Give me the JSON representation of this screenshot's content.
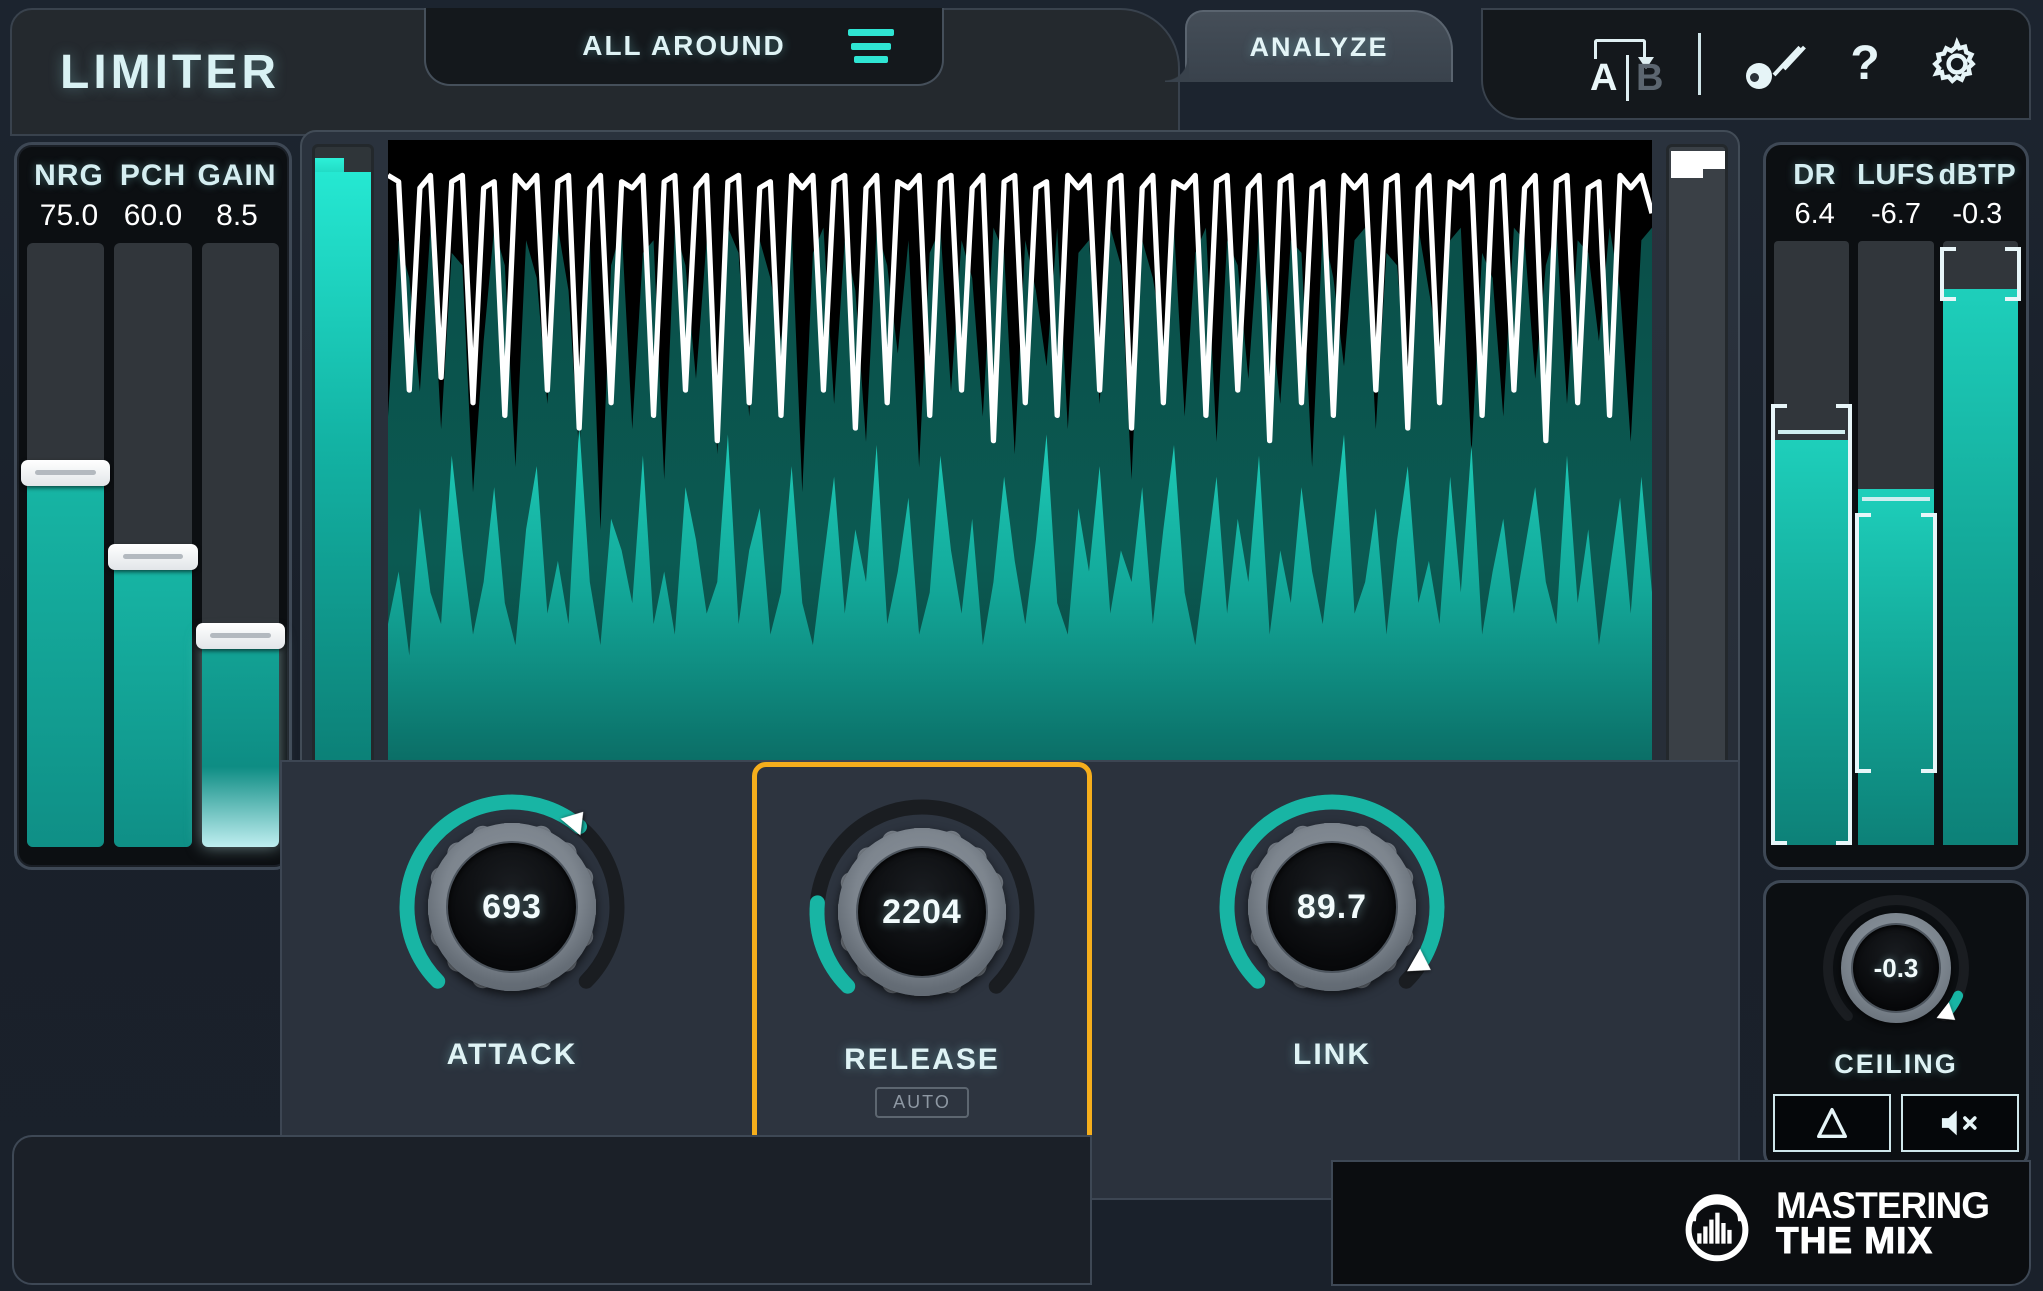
{
  "header": {
    "brand": "LIMITER",
    "preset_tab": "ALL AROUND",
    "menu_icon": "hamburger-icon",
    "analyze_tab": "ANALYZE",
    "ab_a": "A",
    "ab_b": "B",
    "help_label": "?",
    "wand_icon": "magic-wand-icon",
    "gear_icon": "gear-icon"
  },
  "left_meters": {
    "columns": [
      {
        "label": "NRG",
        "value": "75.0",
        "fill_pct": 62,
        "handle_pct": 62,
        "glow": false
      },
      {
        "label": "PCH",
        "value": "60.0",
        "fill_pct": 48,
        "handle_pct": 48,
        "glow": false
      },
      {
        "label": "GAIN",
        "value": "8.5",
        "fill_pct": 35,
        "handle_pct": 35,
        "glow": true
      }
    ]
  },
  "right_meters": {
    "columns": [
      {
        "label": "DR",
        "value": "6.4",
        "fill_pct": 67,
        "bracket_top_pct": 73,
        "bracket_height_pct": 73,
        "tick_pct": 68
      },
      {
        "label": "LUFS",
        "value": "-6.7",
        "fill_pct": 59,
        "bracket_top_pct": 55,
        "bracket_height_pct": 43,
        "tick_pct": 57
      },
      {
        "label": "dBTP",
        "value": "-0.3",
        "fill_pct": 92,
        "bracket_top_pct": 99,
        "bracket_height_pct": 9,
        "tick_pct": 0
      }
    ]
  },
  "gain_meter": {
    "input_level_pct": 96,
    "output_marker_pct": 3
  },
  "knobs": [
    {
      "name": "ATTACK",
      "value": "693",
      "arc_start_deg": -135,
      "arc_end_deg": 40,
      "selected": false,
      "auto": null
    },
    {
      "name": "RELEASE",
      "value": "2204",
      "arc_start_deg": -135,
      "arc_end_deg": -85,
      "selected": true,
      "auto": "AUTO"
    },
    {
      "name": "LINK",
      "value": "89.7",
      "arc_start_deg": -135,
      "arc_end_deg": 120,
      "selected": false,
      "auto": null
    }
  ],
  "ceiling": {
    "name": "CEILING",
    "value": "-0.3",
    "arc_start_deg": -135,
    "arc_end_deg": 128,
    "delta_icon": "delta-icon",
    "mute_icon": "mute-icon"
  },
  "footer": {
    "logo_line1": "MASTERING",
    "logo_line2": "THE MIX"
  },
  "chart_data": {
    "type": "area",
    "title": "Limiter waveform analyzer",
    "xlabel": "",
    "ylabel": "",
    "series": [
      {
        "name": "input-waveform",
        "color": "#0b564f",
        "values": [
          58,
          86,
          80,
          62,
          88,
          56,
          84,
          82,
          46,
          70,
          88,
          82,
          50,
          86,
          80,
          60,
          88,
          78,
          52,
          86,
          40,
          82,
          88,
          56,
          84,
          86,
          48,
          88,
          82,
          64,
          86,
          52,
          88,
          84,
          58,
          86,
          80,
          70,
          88,
          46,
          84,
          88,
          60,
          86,
          78,
          54,
          88,
          82,
          68,
          86,
          50,
          84,
          88,
          62,
          86,
          80,
          58,
          88,
          84,
          52,
          86,
          78,
          66,
          88,
          56,
          84,
          86,
          60,
          88,
          82,
          48,
          86,
          80,
          70,
          88,
          58,
          84,
          88,
          54,
          86,
          82,
          64,
          88,
          76,
          60,
          86,
          84,
          50,
          88,
          80,
          66,
          86,
          88,
          56,
          84,
          82,
          62,
          88,
          78,
          68,
          86,
          88,
          52,
          84,
          80,
          58,
          88,
          86,
          64,
          82,
          88,
          60,
          86,
          84,
          70,
          88,
          78,
          54,
          86,
          88
        ]
      },
      {
        "name": "output-waveform",
        "color": "#12a396",
        "values": [
          30,
          40,
          24,
          52,
          36,
          30,
          62,
          44,
          28,
          38,
          56,
          34,
          26,
          48,
          60,
          32,
          42,
          30,
          68,
          38,
          26,
          50,
          44,
          34,
          62,
          30,
          40,
          28,
          56,
          46,
          32,
          38,
          66,
          30,
          44,
          52,
          28,
          36,
          60,
          34,
          26,
          42,
          58,
          32,
          48,
          38,
          64,
          30,
          40,
          54,
          28,
          36,
          62,
          44,
          32,
          50,
          26,
          38,
          58,
          42,
          30,
          46,
          66,
          34,
          28,
          52,
          40,
          60,
          32,
          44,
          38,
          56,
          30,
          48,
          64,
          36,
          26,
          42,
          58,
          32,
          50,
          38,
          62,
          28,
          44,
          34,
          56,
          40,
          30,
          48,
          66,
          32,
          38,
          52,
          28,
          46,
          60,
          34,
          42,
          30,
          58,
          36,
          64,
          28,
          40,
          50,
          32,
          44,
          56,
          38,
          30,
          62,
          34,
          48,
          26,
          40,
          54,
          32,
          58,
          36
        ]
      },
      {
        "name": "gain-reduction",
        "color": "#ffffff",
        "values": [
          96,
          95,
          62,
          94,
          96,
          64,
          95,
          96,
          60,
          94,
          95,
          58,
          96,
          94,
          96,
          62,
          95,
          96,
          56,
          94,
          96,
          60,
          95,
          94,
          96,
          58,
          95,
          96,
          62,
          94,
          96,
          54,
          95,
          96,
          60,
          94,
          95,
          58,
          96,
          94,
          96,
          62,
          95,
          96,
          56,
          94,
          96,
          60,
          95,
          94,
          96,
          58,
          95,
          96,
          62,
          94,
          96,
          54,
          95,
          96,
          60,
          94,
          95,
          58,
          96,
          94,
          96,
          62,
          95,
          96,
          56,
          94,
          96,
          60,
          95,
          94,
          96,
          58,
          95,
          96,
          62,
          94,
          96,
          54,
          95,
          96,
          60,
          94,
          95,
          58,
          96,
          94,
          96,
          62,
          95,
          96,
          56,
          94,
          96,
          60,
          95,
          94,
          96,
          58,
          95,
          96,
          62,
          94,
          96,
          54,
          95,
          96,
          60,
          94,
          95,
          58,
          96,
          94,
          96,
          90
        ]
      }
    ],
    "ylim": [
      0,
      100
    ],
    "grid": false,
    "legend": "none"
  }
}
